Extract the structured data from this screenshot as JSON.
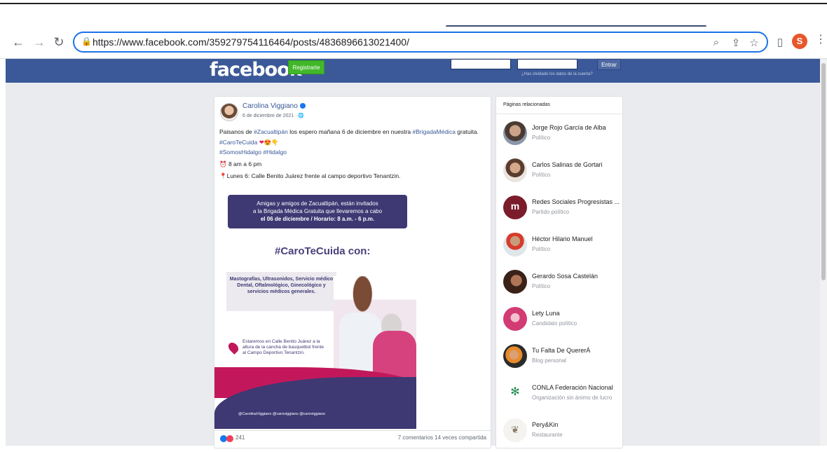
{
  "browser": {
    "url": "https://www.facebook.com/359279754116464/posts/4836896613021400/",
    "profile_initial": "S"
  },
  "header": {
    "logo": "facebook",
    "register_label": "Registrarte",
    "enter_label": "Entrar",
    "forgot_label": "¿Has olvidado los datos de la cuenta?"
  },
  "post": {
    "author": "Carolina Viggiano",
    "date": "6 de diciembre de 2021 · ",
    "line1_pre": "Paisanos de ",
    "line1_tag1": "#Zacualtipán",
    "line1_mid": " los espero mañana 6 de diciembre en nuestra ",
    "line1_tag2": "#BrigadaMédica",
    "line1_post": " gratuita.",
    "tags_line": "#CaroTeCuida",
    "tags_line2": "#SomosHidalgo #Hidalgo",
    "hours": "8 am a 6 pm",
    "location": "Lunes 6: Calle Benito Juárez frente al campo deportivo Tenantzin.",
    "flyer": {
      "header_line1": "Amigas y amigos de Zacualtipán, están invitados",
      "header_line2": "a la Brigada Médica Gratuita que llevaremos a cabo",
      "header_line3": "el 06 de diciembre / Horario: 8 a.m. - 6 p.m.",
      "title": "#CaroTeCuida con:",
      "services": "Mastografías, Ultrasonidos, Servicio médico Dental, Oftalmológico, Ginecológico y servicios médicos generales.",
      "location": "Estaremos en Calle Benito Juárez a la altura de la cancha de basquetbol frente al Campo Deportivo Tenantzin.",
      "social": "@CarolinaViggiano    @caroviggiano    @caroviggiano"
    },
    "reactions_count": "241",
    "comments_shares": "7 comentarios  14 veces compartida"
  },
  "sidebar": {
    "title": "Páginas relacionadas",
    "items": [
      {
        "name": "Jorge Rojo García de Alba",
        "category": "Político"
      },
      {
        "name": "Carlos Salinas de Gortari",
        "category": "Político"
      },
      {
        "name": "Redes Sociales Progresistas ...",
        "category": "Partido político"
      },
      {
        "name": "Héctor Hilario Manuel",
        "category": "Político"
      },
      {
        "name": "Gerardo Sosa Castelán",
        "category": "Político"
      },
      {
        "name": "Lety Luna",
        "category": "Candidato político"
      },
      {
        "name": "Tu Falta De QuererÁ",
        "category": "Blog personal"
      },
      {
        "name": "CONLA Federación Nacional",
        "category": "Organización sin ánimo de lucro"
      },
      {
        "name": "Pery&Kin",
        "category": "Restaurante"
      }
    ]
  },
  "colors": {
    "fb_blue": "#3b5998",
    "link": "#385898",
    "register_green": "#42b72a",
    "flyer_purple": "#3e3873",
    "flyer_magenta": "#c2185b"
  }
}
